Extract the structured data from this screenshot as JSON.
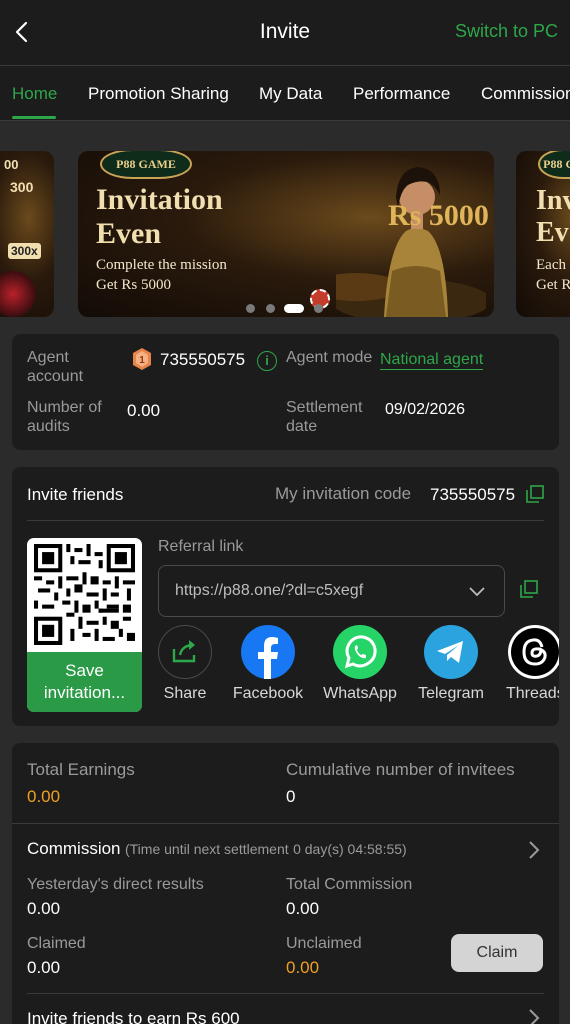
{
  "header": {
    "title": "Invite",
    "switch_label": "Switch to PC"
  },
  "tabs": [
    {
      "label": "Home",
      "active": true
    },
    {
      "label": "Promotion Sharing"
    },
    {
      "label": "My Data"
    },
    {
      "label": "Performance"
    },
    {
      "label": "Commission"
    }
  ],
  "banner": {
    "logo_text": "P88 GAME",
    "title_line1": "Invitation",
    "title_line2": "Even",
    "sub_line1": "Complete the mission",
    "sub_line2": "Get Rs 5000",
    "amount": "Rs 5000",
    "side_right_title": "Inv",
    "side_right_title2": "Ev",
    "side_right_sub1": "Each",
    "side_right_sub2": "Get R",
    "side_left_text1": "00",
    "side_left_text2": "300",
    "side_left_text3": "300x",
    "active_dot": 2
  },
  "agent": {
    "account_label": "Agent account",
    "account_value": "735550575",
    "mode_label": "Agent mode",
    "mode_value": "National agent",
    "audits_label": "Number of audits",
    "audits_value": "0.00",
    "settlement_label": "Settlement date",
    "settlement_value": "09/02/2026",
    "medal_rank": "1"
  },
  "invite": {
    "title": "Invite friends",
    "code_label": "My invitation code",
    "code_value": "735550575",
    "save_label": "Save invitation...",
    "ref_label": "Referral link",
    "ref_value": "https://p88.one/?dl=c5xegf",
    "share": [
      {
        "name": "Share",
        "icon": "share-icon"
      },
      {
        "name": "Facebook",
        "icon": "facebook-icon"
      },
      {
        "name": "WhatsApp",
        "icon": "whatsapp-icon"
      },
      {
        "name": "Telegram",
        "icon": "telegram-icon"
      },
      {
        "name": "Threads",
        "icon": "threads-icon"
      }
    ]
  },
  "earnings": {
    "total_label": "Total Earnings",
    "total_value": "0.00",
    "invitees_label": "Cumulative number of invitees",
    "invitees_value": "0",
    "commission_title": "Commission",
    "commission_note": "(Time until next settlement",
    "commission_time": "0 day(s) 04:58:55)",
    "yesterday_label": "Yesterday's direct results",
    "yesterday_value": "0.00",
    "total_commission_label": "Total Commission",
    "total_commission_value": "0.00",
    "claimed_label": "Claimed",
    "claimed_value": "0.00",
    "unclaimed_label": "Unclaimed",
    "unclaimed_value": "0.00",
    "claim_button": "Claim",
    "invite_earn": "Invite friends to earn Rs 600"
  },
  "colors": {
    "accent": "#2ea64a",
    "orange": "#f0a020",
    "bg": "#2b2b2b",
    "card": "#1c1c1c"
  }
}
